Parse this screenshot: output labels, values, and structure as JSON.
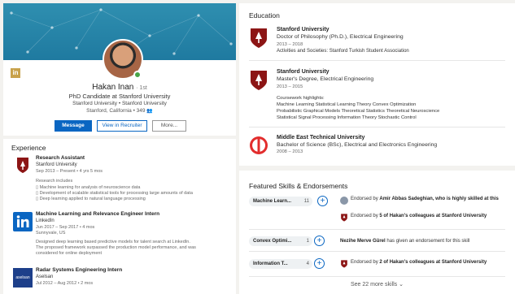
{
  "profile": {
    "name": "Hakan Inan",
    "degree": "· 1st",
    "headline": "PhD Candidate at Stanford University",
    "schools": "Stanford University • Stanford University",
    "location": "Stanford, California • 349",
    "actions": {
      "message": "Message",
      "recruiter": "View in Recruiter",
      "more": "More..."
    }
  },
  "experience": {
    "title": "Experience",
    "items": [
      {
        "role": "Research Assistant",
        "company": "Stanford University",
        "dates": "Sep 2013 – Present  •  4 yrs 5 mos",
        "desc_intro": "Research includes",
        "bullets": [
          "Machine learning for analysis of neuroscience data",
          "Development of scalable statistical tools for processing large amounts of data",
          "Deep learning applied to natural language processing"
        ]
      },
      {
        "role": "Machine Learning and Relevance Engineer Intern",
        "company": "LinkedIn",
        "dates": "Jun 2017 – Sep 2017  •  4 mos",
        "location": "Sunnyvale, US",
        "desc": [
          "Designed deep learning based predictive models for talent search at LinkedIn.",
          "The proposed framework surpassed the production model performance, and was",
          "considered for online deployment"
        ]
      },
      {
        "role": "Radar Systems Engineering Intern",
        "company": "Aselsan",
        "dates": "Jul 2012 – Aug 2012  •  2 mos"
      }
    ]
  },
  "education": {
    "title": "Education",
    "items": [
      {
        "school": "Stanford University",
        "degree": "Doctor of Philosophy (Ph.D.), Electrical Engineering",
        "dates": "2013 – 2018",
        "activities": "Activities and Societies: Stanford Turkish Student Association"
      },
      {
        "school": "Stanford University",
        "degree": "Master's Degree, Electrical Engineering",
        "dates": "2013 – 2015",
        "highlights_label": "Coursework highlights:",
        "highlights": [
          "Machine Learning Statistical Learning Theory Convex Optimization",
          "Probabilistic Graphical Models Theoretical Statistics Theoretical Neuroscience",
          "Statistical Signal Processing Information Theory Stochastic Control"
        ]
      },
      {
        "school": "Middle East Technical University",
        "degree": "Bachelor of Science (BSc), Electrical and Electronics Engineering",
        "dates": "2008 – 2013"
      }
    ]
  },
  "skills": {
    "title": "Featured Skills & Endorsements",
    "items": [
      {
        "name": "Machine Learn...",
        "count": "11",
        "endorsements": [
          {
            "pre": "Endorsed by ",
            "bold": "Amir Abbas Sadeghian, who is highly skilled at this",
            "post": ""
          },
          {
            "pre": "Endorsed by ",
            "bold": "5 of Hakan's colleagues at Stanford University",
            "post": ""
          }
        ]
      },
      {
        "name": "Convex Optimi...",
        "count": "1",
        "endorsements": [
          {
            "pre": "",
            "bold": "Nezihe Merve Gürel",
            "post": " has given an endorsement for this skill"
          }
        ]
      },
      {
        "name": "Information T...",
        "count": "4",
        "endorsements": [
          {
            "pre": "Endorsed by ",
            "bold": "2 of Hakan's colleagues at Stanford University",
            "post": ""
          }
        ]
      }
    ],
    "see_more": "See 22 more skills"
  },
  "colors": {
    "accent": "#0a66c2",
    "stanford": "#8c1515",
    "linkedin": "#0a66c2",
    "aselsan": "#1d3f8a",
    "metu": "#e22d2d"
  }
}
